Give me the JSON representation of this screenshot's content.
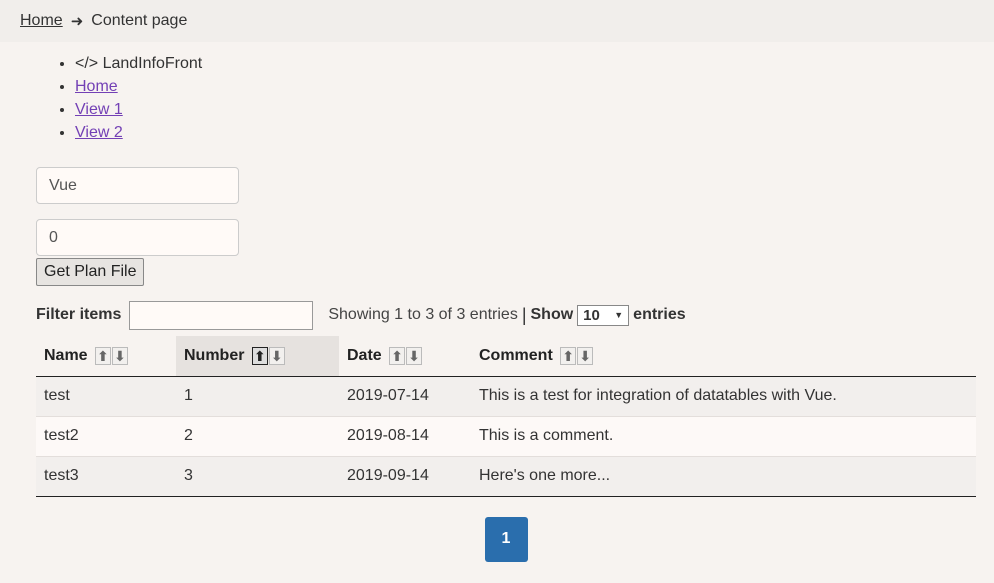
{
  "breadcrumb": {
    "home": "Home",
    "current": "Content page"
  },
  "nav": {
    "brand": "</> LandInfoFront",
    "items": [
      "Home",
      "View 1",
      "View 2"
    ]
  },
  "form": {
    "field1_value": "Vue",
    "field2_value": "0",
    "button_label": "Get Plan File"
  },
  "table_controls": {
    "filter_label": "Filter items",
    "filter_value": "",
    "info": "Showing 1 to 3 of 3 entries",
    "separator": "|",
    "show_label": "Show",
    "page_size": "10",
    "entries_label": "entries"
  },
  "table": {
    "columns": [
      "Name",
      "Number",
      "Date",
      "Comment"
    ],
    "sorted_column": "Number",
    "sort_direction": "ascending",
    "rows": [
      [
        "test",
        "1",
        "2019-07-14",
        "This is a test for integration of datatables with Vue."
      ],
      [
        "test2",
        "2",
        "2019-08-14",
        "This is a comment."
      ],
      [
        "test3",
        "3",
        "2019-09-14",
        "Here's one more..."
      ]
    ]
  },
  "pagination": {
    "current": "1"
  },
  "colors": {
    "background": "#f7f3f0",
    "link": "#7340b5",
    "page_button": "#2a6ead"
  }
}
